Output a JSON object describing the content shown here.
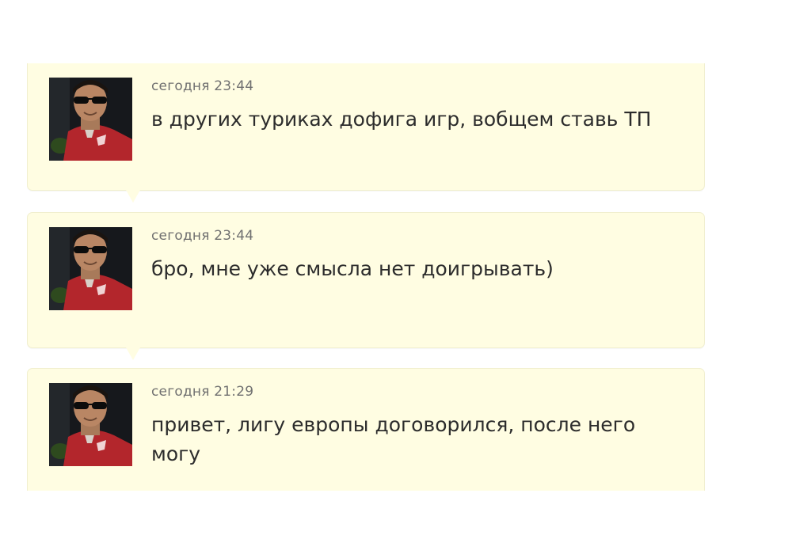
{
  "messages": [
    {
      "timestamp": "сегодня 23:44",
      "text": "в других туриках дофига игр, вобщем ставь ТП",
      "avatar_icon": "user-avatar-photo"
    },
    {
      "timestamp": "сегодня 23:44",
      "text": "бро, мне уже смысла нет доигрывать)",
      "avatar_icon": "user-avatar-photo"
    },
    {
      "timestamp": "сегодня 21:29",
      "text": "привет, лигу европы договорился, после него могу",
      "avatar_icon": "user-avatar-photo"
    }
  ],
  "colors": {
    "bubble_background": "#fffde2",
    "bubble_border": "#f1efcf",
    "timestamp_text": "#707070",
    "message_text": "#2c2c2c",
    "jersey_red": "#b3262c"
  }
}
